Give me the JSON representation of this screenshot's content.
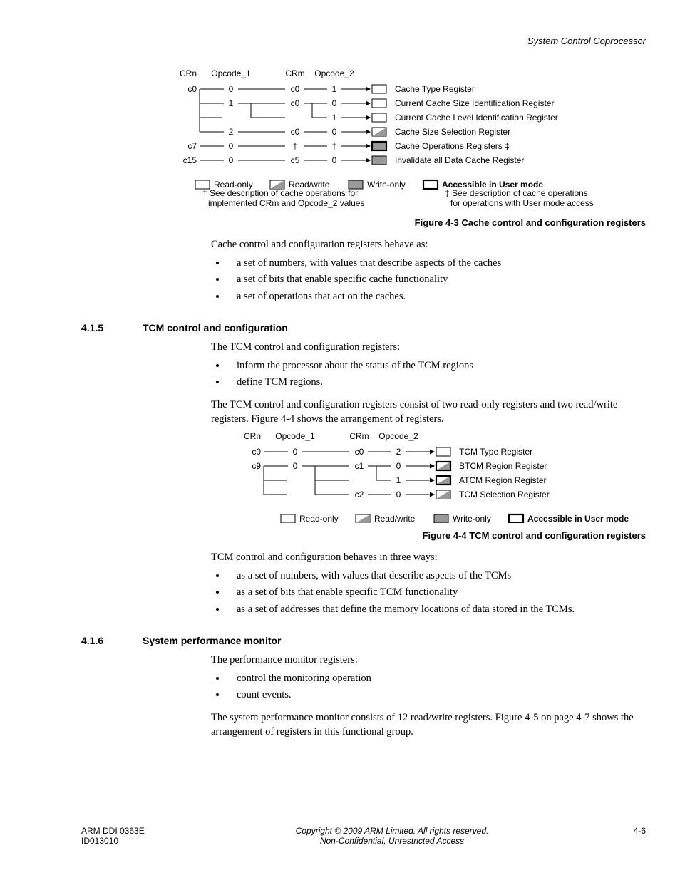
{
  "header": {
    "title": "System Control Coprocessor"
  },
  "fig1": {
    "caption": "Figure 4-3 Cache control and configuration registers",
    "cols": {
      "crn": "CRn",
      "op1": "Opcode_1",
      "crm": "CRm",
      "op2": "Opcode_2"
    },
    "rows": [
      {
        "crn": "c0",
        "op1": "0",
        "crm": "c0",
        "op2": "1",
        "label": "Cache Type Register",
        "mode": "ro",
        "user": false
      },
      {
        "crn": "",
        "op1": "1",
        "crm": "c0",
        "op2": "0",
        "label": "Current Cache Size Identification Register",
        "mode": "ro",
        "user": false
      },
      {
        "crn": "",
        "op1": "",
        "crm": "",
        "op2": "1",
        "label": "Current Cache Level Identification Register",
        "mode": "ro",
        "user": false
      },
      {
        "crn": "",
        "op1": "2",
        "crm": "c0",
        "op2": "0",
        "label": "Cache Size Selection Register",
        "mode": "rw",
        "user": false
      },
      {
        "crn": "c7",
        "op1": "0",
        "crm": "†",
        "op2": "†",
        "label": "Cache Operations Registers ‡",
        "mode": "wo",
        "user": true
      },
      {
        "crn": "c15",
        "op1": "0",
        "crm": "c5",
        "op2": "0",
        "label": "Invalidate all Data Cache Register",
        "mode": "wo",
        "user": false
      }
    ],
    "legend": {
      "ro": "Read-only",
      "rw": "Read/write",
      "wo": "Write-only",
      "user": "Accessible in User mode"
    },
    "notes": {
      "dagger": "† See description of cache operations for implemented CRm and Opcode_2 values",
      "ddagger": "‡ See description of cache operations for operations with User mode access"
    }
  },
  "para1": "Cache control and configuration registers behave as:",
  "list1": [
    "a set of numbers, with values that describe aspects of the caches",
    "a set of bits that enable specific cache functionality",
    "a set of operations that act on the caches."
  ],
  "sec415": {
    "num": "4.1.5",
    "title": "TCM control and configuration"
  },
  "para2": "The TCM control and configuration registers:",
  "list2": [
    "inform the processor about the status of the TCM regions",
    "define TCM regions."
  ],
  "para3": "The TCM control and configuration registers consist of two read-only registers and two read/write registers. Figure 4-4 shows the arrangement of registers.",
  "fig2": {
    "caption": "Figure 4-4 TCM control and configuration registers",
    "cols": {
      "crn": "CRn",
      "op1": "Opcode_1",
      "crm": "CRm",
      "op2": "Opcode_2"
    },
    "rows": [
      {
        "crn": "c0",
        "op1": "0",
        "crm": "c0",
        "op2": "2",
        "label": "TCM Type Register",
        "mode": "ro",
        "user": false
      },
      {
        "crn": "c9",
        "op1": "0",
        "crm": "c1",
        "op2": "0",
        "label": "BTCM Region Register",
        "mode": "rw",
        "user": true
      },
      {
        "crn": "",
        "op1": "",
        "crm": "",
        "op2": "1",
        "label": "ATCM Region Register",
        "mode": "rw",
        "user": true
      },
      {
        "crn": "",
        "op1": "",
        "crm": "c2",
        "op2": "0",
        "label": "TCM Selection Register",
        "mode": "rw",
        "user": false
      }
    ],
    "legend": {
      "ro": "Read-only",
      "rw": "Read/write",
      "wo": "Write-only",
      "user": "Accessible in User mode"
    }
  },
  "para4": "TCM control and configuration behaves in three ways:",
  "list3": [
    "as a set of numbers, with values that describe aspects of the TCMs",
    "as a set of bits that enable specific TCM functionality",
    "as a set of addresses that define the memory locations of data stored in the TCMs."
  ],
  "sec416": {
    "num": "4.1.6",
    "title": "System performance monitor"
  },
  "para5": "The performance monitor registers:",
  "list4": [
    "control the monitoring operation",
    "count events."
  ],
  "para6": "The system performance monitor consists of 12 read/write registers. Figure 4-5 on page 4-7 shows the arrangement of registers in this functional group.",
  "footer": {
    "left1": "ARM DDI 0363E",
    "left2": "ID013010",
    "mid1": "Copyright © 2009 ARM Limited. All rights reserved.",
    "mid2": "Non-Confidential, Unrestricted Access",
    "right": "4-6"
  }
}
